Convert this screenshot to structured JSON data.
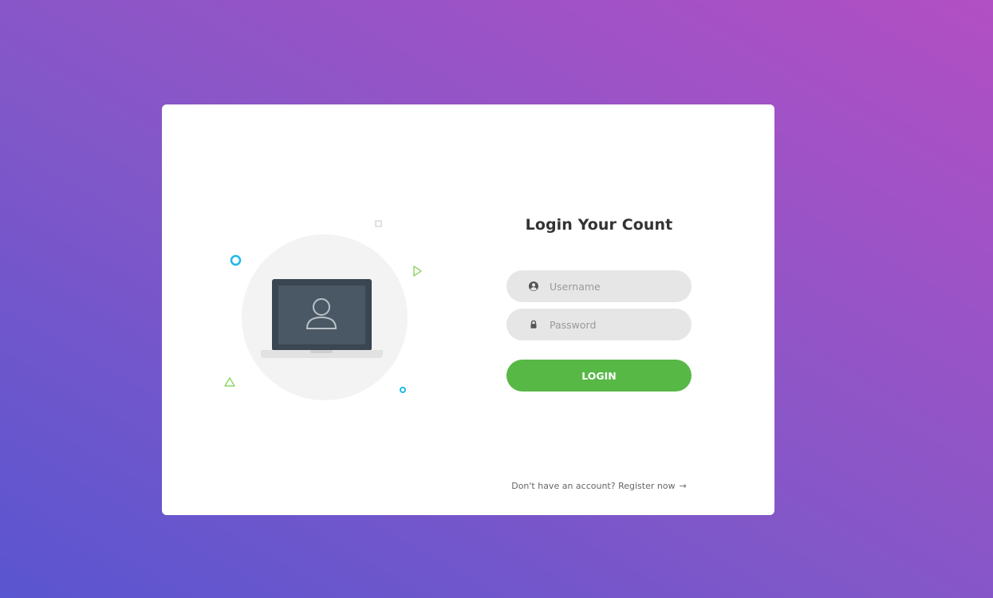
{
  "login": {
    "title": "Login Your Count",
    "username_placeholder": "Username",
    "password_placeholder": "Password",
    "username_icon": "user-circle-icon",
    "password_icon": "lock-icon",
    "submit_label": "LOGIN",
    "register_text": "Don't have an account? Register now",
    "register_arrow": "→"
  },
  "colors": {
    "accent_green": "#57b846",
    "field_bg": "#e6e6e6",
    "decor_blue": "#1db8e8",
    "decor_green": "#8fd66a",
    "laptop_dark": "#3a4652",
    "gradient_start": "#5a55d0",
    "gradient_end": "#b24fc4"
  }
}
